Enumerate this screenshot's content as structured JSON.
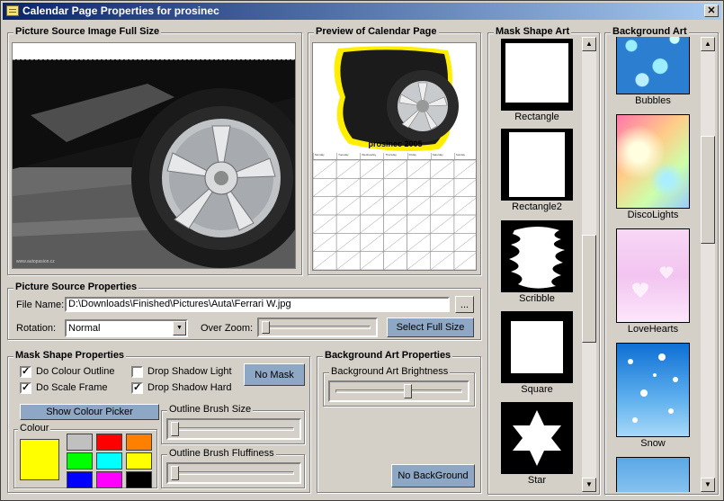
{
  "window": {
    "title": "Calendar Page Properties for prosinec"
  },
  "picture_source_full": {
    "label": "Picture Source Image Full Size",
    "watermark": "www.autopasion.cz"
  },
  "preview": {
    "label": "Preview of Calendar Page",
    "caption": "prosinec 2005",
    "weekdays": [
      "Monday",
      "Tuesday",
      "Wednesday",
      "Thursday",
      "Friday",
      "Saturday",
      "Sunday"
    ]
  },
  "picture_source_props": {
    "label": "Picture Source Properties",
    "file_label": "File Name:",
    "file_value": "D:\\Downloads\\Finished\\Pictures\\Auta\\Ferrari W.jpg",
    "browse_label": "...",
    "rotation_label": "Rotation:",
    "rotation_value": "Normal",
    "over_zoom_label": "Over Zoom:",
    "select_full_label": "Select Full Size",
    "over_zoom_level": 0
  },
  "mask_shape_props": {
    "label": "Mask Shape Properties",
    "do_colour_outline": "Do Colour Outline",
    "do_scale_frame": "Do Scale Frame",
    "drop_shadow_light": "Drop Shadow Light",
    "drop_shadow_hard": "Drop Shadow Hard",
    "no_mask": "No Mask",
    "show_colour_picker": "Show Colour Picker",
    "colour_label": "Colour",
    "outline_brush_size_label": "Outline Brush Size",
    "outline_brush_fluff_label": "Outline Brush Fluffiness",
    "checks": {
      "do_colour_outline": true,
      "do_scale_frame": true,
      "drop_shadow_light": false,
      "drop_shadow_hard": true
    },
    "selected_colour": "#ffff00",
    "palette": [
      "#c0c0c0",
      "#ff0000",
      "#ff8000",
      "#00ff00",
      "#00ffff",
      "#ffff00",
      "#0000ff",
      "#ff00ff",
      "#000000"
    ],
    "outline_brush_size_level": 0,
    "outline_brush_fluff_level": 0
  },
  "background_art_props": {
    "label": "Background Art Properties",
    "brightness_label": "Background Art Brightness",
    "brightness_level": 0.58,
    "no_background": "No BackGround"
  },
  "mask_shape_art": {
    "label": "Mask Shape Art",
    "items": [
      "Rectangle",
      "Rectangle2",
      "Scribble",
      "Square",
      "Star"
    ]
  },
  "background_art": {
    "label": "Background Art",
    "items": [
      "Bubbles",
      "DiscoLights",
      "LoveHearts",
      "Snow"
    ]
  }
}
